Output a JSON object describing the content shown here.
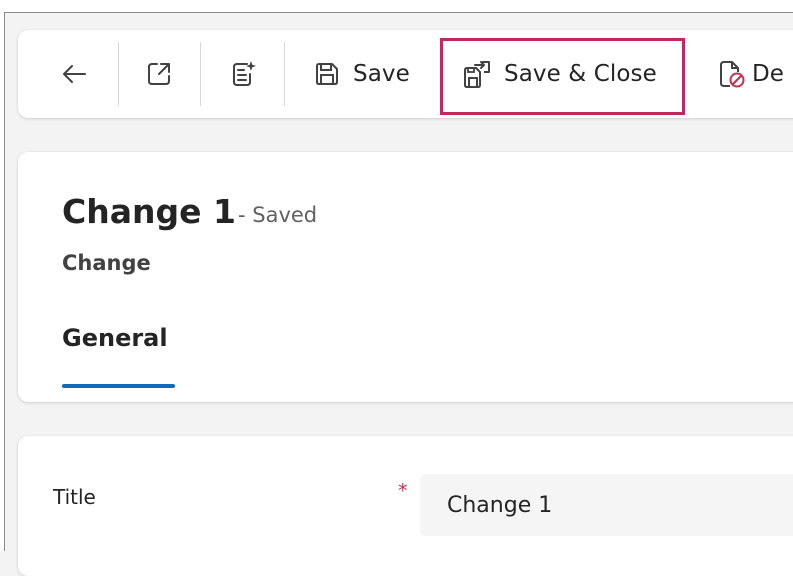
{
  "command_bar": {
    "back_icon": "arrow-left-icon",
    "open_new_window_icon": "open-in-new-window-icon",
    "form_fill_icon": "form-fill-icon",
    "save_icon": "floppy-disk-icon",
    "save_label": "Save",
    "save_close_icon": "save-and-close-icon",
    "save_close_label": "Save & Close",
    "deactivate_icon": "document-prohibited-icon",
    "deactivate_label_visible": "De"
  },
  "header": {
    "title": "Change 1",
    "status": "- Saved",
    "entity": "Change",
    "tabs": [
      {
        "label": "General",
        "selected": true
      }
    ]
  },
  "form": {
    "fields": [
      {
        "label": "Title",
        "required_marker": "*",
        "value": "Change 1"
      }
    ]
  },
  "colors": {
    "highlight_border": "#c4285a",
    "tab_underline": "#0f6cbd",
    "required": "#c4314b"
  }
}
